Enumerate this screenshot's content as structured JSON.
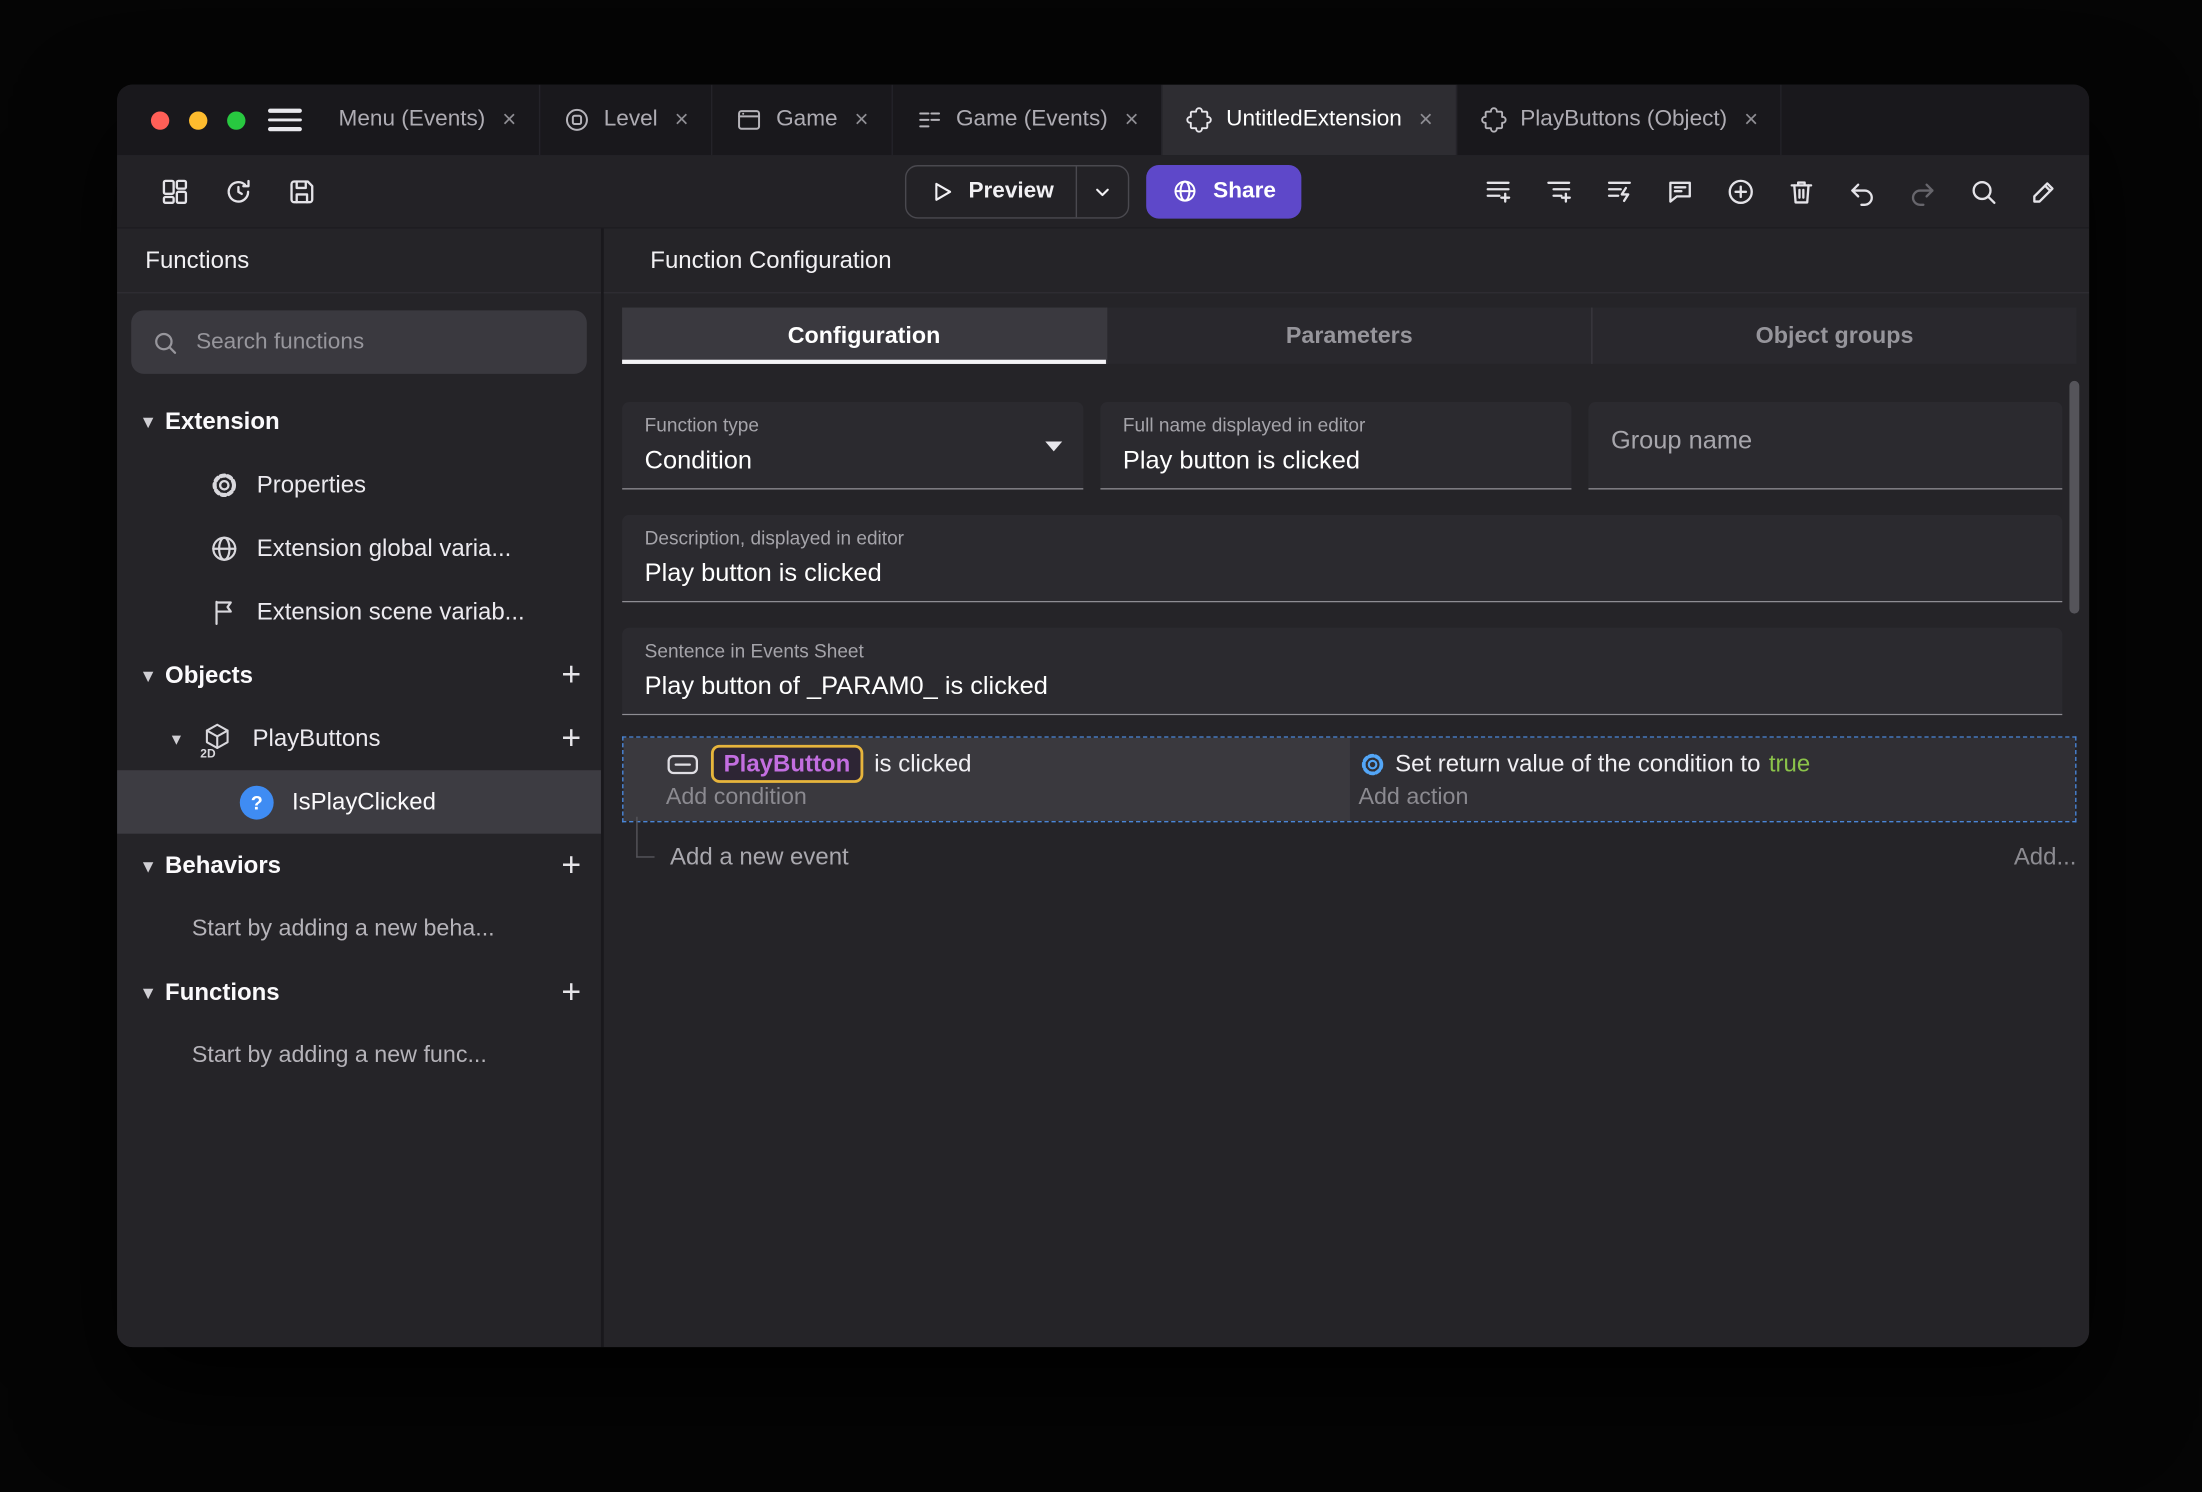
{
  "glyphs": {
    "close": "×",
    "plus": "+",
    "chevron_down": "▾",
    "question_mark": "?",
    "two_d_badge": "2D"
  },
  "titlebar": {
    "tabs": [
      {
        "label": "Menu (Events)"
      },
      {
        "label": "Level"
      },
      {
        "label": "Game"
      },
      {
        "label": "Game (Events)"
      },
      {
        "label": "UntitledExtension"
      },
      {
        "label": "PlayButtons (Object)"
      }
    ]
  },
  "toolbar": {
    "preview_label": "Preview",
    "share_label": "Share"
  },
  "sidebar": {
    "title": "Functions",
    "search_placeholder": "Search functions",
    "extension": {
      "label": "Extension",
      "items": [
        "Properties",
        "Extension global varia...",
        "Extension scene variab..."
      ]
    },
    "objects": {
      "label": "Objects",
      "object_name": "PlayButtons",
      "function_name": "IsPlayClicked"
    },
    "behaviors": {
      "label": "Behaviors",
      "hint": "Start by adding a new beha..."
    },
    "functions": {
      "label": "Functions",
      "hint": "Start by adding a new func..."
    }
  },
  "main": {
    "title": "Function Configuration",
    "tabs": [
      {
        "label": "Configuration"
      },
      {
        "label": "Parameters"
      },
      {
        "label": "Object groups"
      }
    ],
    "fields": {
      "function_type": {
        "label": "Function type",
        "value": "Condition"
      },
      "full_name": {
        "label": "Full name displayed in editor",
        "value": "Play button is clicked"
      },
      "group_name": {
        "label": "Group name",
        "value": ""
      },
      "description": {
        "label": "Description, displayed in editor",
        "value": "Play button is clicked"
      },
      "sentence": {
        "label": "Sentence in Events Sheet",
        "value": "Play button of _PARAM0_ is clicked"
      }
    },
    "events": {
      "condition_object": "PlayButton",
      "condition_suffix": "is clicked",
      "add_condition": "Add condition",
      "action_prefix": "Set return value of the condition to",
      "action_value": "true",
      "add_action": "Add action",
      "add_new_event": "Add a new event",
      "add_button": "Add..."
    }
  },
  "colors": {
    "share_accent": "#5e48c9",
    "event_selection_border": "#4a86d8",
    "object_chip_border": "#e7b53c",
    "object_chip_text": "#c36ee0",
    "boolean_true_text": "#8bc34a",
    "traffic_close": "#ff5f57",
    "traffic_minimize": "#febc2e",
    "traffic_zoom": "#28c840"
  }
}
